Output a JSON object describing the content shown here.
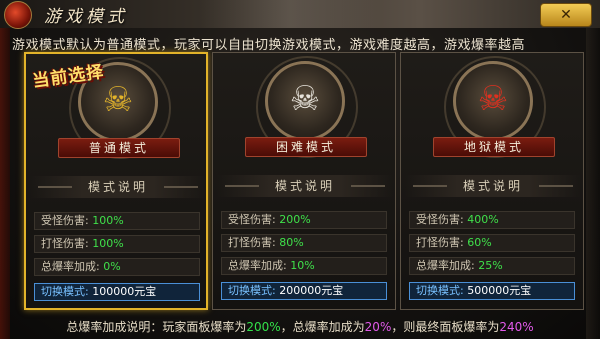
{
  "window": {
    "title": "游戏模式",
    "close_label": "✕"
  },
  "description": "游戏模式默认为普通模式，玩家可以自由切换游戏模式，游戏难度越高，游戏爆率越高",
  "current_badge": "当前选择",
  "section_label": "模式说明",
  "modes": [
    {
      "name": "普通模式",
      "icon": "golden-demon-mask-icon",
      "rows": [
        {
          "label": "受怪伤害:",
          "value": "100%"
        },
        {
          "label": "打怪伤害:",
          "value": "100%"
        },
        {
          "label": "总爆率加成:",
          "value": "0%"
        }
      ],
      "switch": {
        "label": "切换模式:",
        "value": "100000元宝"
      }
    },
    {
      "name": "困难模式",
      "icon": "horned-skull-icon",
      "rows": [
        {
          "label": "受怪伤害:",
          "value": "200%"
        },
        {
          "label": "打怪伤害:",
          "value": "80%"
        },
        {
          "label": "总爆率加成:",
          "value": "10%"
        }
      ],
      "switch": {
        "label": "切换模式:",
        "value": "200000元宝"
      }
    },
    {
      "name": "地狱模式",
      "icon": "red-demon-mask-icon",
      "rows": [
        {
          "label": "受怪伤害:",
          "value": "400%"
        },
        {
          "label": "打怪伤害:",
          "value": "60%"
        },
        {
          "label": "总爆率加成:",
          "value": "25%"
        }
      ],
      "switch": {
        "label": "切换模式:",
        "value": "500000元宝"
      }
    }
  ],
  "footer": {
    "prefix": "总爆率加成说明：玩家面板爆率为",
    "v1": "200%",
    "mid1": "，总爆率加成为",
    "v2": "20%",
    "mid2": "，则最终面板爆率为",
    "v3": "240%"
  },
  "colors": {
    "accent_gold": "#e2b32a",
    "value_green": "#3fe04a",
    "highlight_purple": "#e15aea",
    "switch_blue": "#79c1ff"
  }
}
